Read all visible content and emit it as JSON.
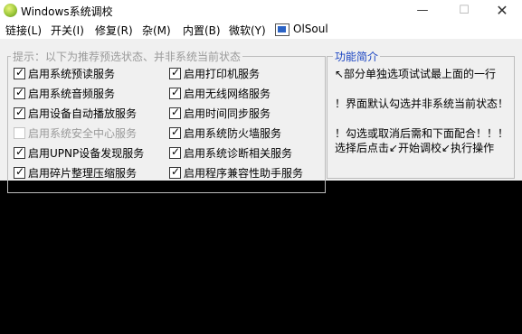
{
  "window": {
    "title": "Windows系统调校",
    "minimize_glyph": "—",
    "maximize_glyph": "☐",
    "close_glyph": "✕"
  },
  "menu": [
    "链接(L)",
    "开关(I)",
    "修复(R)",
    "杂(M)",
    "内置(B)",
    "微软(Y)",
    "OlSoul"
  ],
  "options_group": {
    "legend": "提示：以下为推荐预选状态、并非系统当前状态",
    "left": [
      {
        "label": "启用系统预读服务",
        "checked": true,
        "enabled": true
      },
      {
        "label": "启用系统音频服务",
        "checked": true,
        "enabled": true
      },
      {
        "label": "启用设备自动播放服务",
        "checked": true,
        "enabled": true
      },
      {
        "label": "启用系统安全中心服务",
        "checked": false,
        "enabled": false
      },
      {
        "label": "启用UPNP设备发现服务",
        "checked": true,
        "enabled": true
      },
      {
        "label": "启用碎片整理压缩服务",
        "checked": true,
        "enabled": true
      }
    ],
    "right": [
      {
        "label": "启用打印机服务",
        "checked": true,
        "enabled": true
      },
      {
        "label": "启用无线网络服务",
        "checked": true,
        "enabled": true
      },
      {
        "label": "启用时间同步服务",
        "checked": true,
        "enabled": true
      },
      {
        "label": "启用系统防火墙服务",
        "checked": true,
        "enabled": true
      },
      {
        "label": "启用系统诊断相关服务",
        "checked": true,
        "enabled": true
      },
      {
        "label": "启用程序兼容性助手服务",
        "checked": true,
        "enabled": true
      }
    ]
  },
  "info_group": {
    "legend": "功能简介",
    "lines": [
      "↖部分单独选项试试最上面的一行",
      "！界面默认勾选并非系统当前状态！",
      "！勾选或取消后需和下面配合！！！",
      "选择后点击↙开始调校↙执行操作"
    ]
  }
}
